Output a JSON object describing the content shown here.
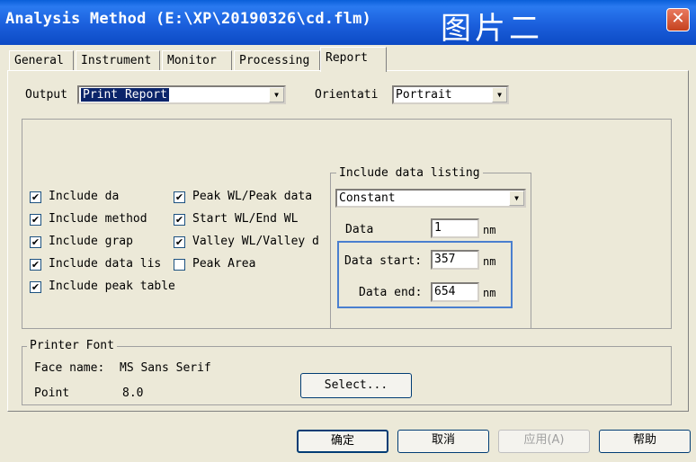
{
  "window": {
    "title": "Analysis Method (E:\\XP\\20190326\\cd.flm)",
    "note": "图片二",
    "close_glyph": "✕"
  },
  "tabs": [
    "General",
    "Instrument",
    "Monitor",
    "Processing",
    "Report"
  ],
  "active_tab": "Report",
  "output": {
    "label": "Output",
    "value": "Print Report"
  },
  "orientation": {
    "label": "Orientati",
    "value": "Portrait"
  },
  "checkboxes_left": [
    {
      "label": "Include da",
      "checked": true
    },
    {
      "label": "Include method",
      "checked": true
    },
    {
      "label": "Include grap",
      "checked": true
    },
    {
      "label": "Include data lis",
      "checked": true
    },
    {
      "label": "Include peak table",
      "checked": true
    }
  ],
  "checkboxes_right": [
    {
      "label": "Peak WL/Peak data",
      "checked": true
    },
    {
      "label": "Start WL/End WL",
      "checked": true
    },
    {
      "label": "Valley WL/Valley d",
      "checked": true
    },
    {
      "label": "Peak Area",
      "checked": false
    }
  ],
  "check_glyph": "✔",
  "data_listing": {
    "title": "Include data listing",
    "mode": "Constant",
    "data_label": "Data",
    "data_value": "1",
    "start_label": "Data start:",
    "start_value": "357",
    "end_label": "Data end:",
    "end_value": "654",
    "unit": "nm"
  },
  "printer_font": {
    "title": "Printer Font",
    "face_label": "Face name:",
    "face_value": "MS Sans Serif",
    "point_label": "Point",
    "point_value": "8.0",
    "select_button": "Select..."
  },
  "buttons": {
    "ok": "确定",
    "cancel": "取消",
    "apply": "应用(A)",
    "help": "帮助"
  }
}
